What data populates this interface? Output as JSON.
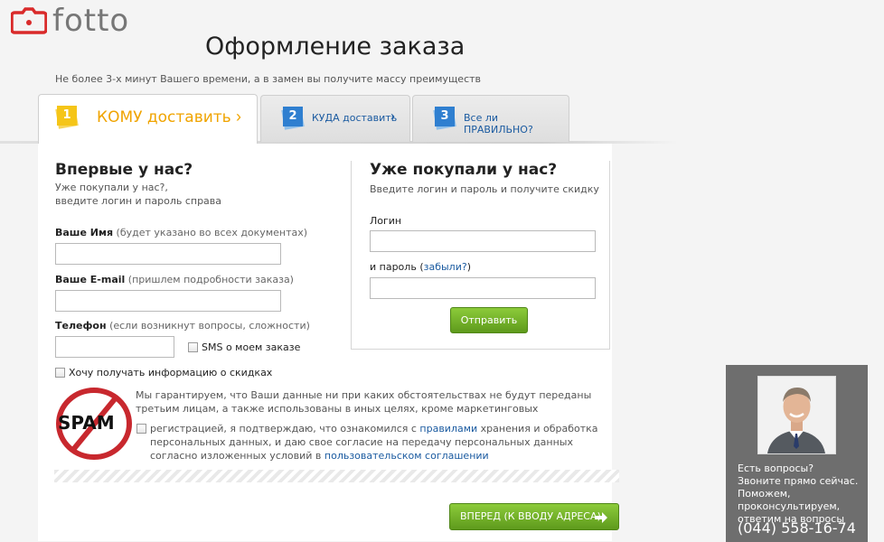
{
  "logo": {
    "text": "fotto",
    "brand_color": "#d92a2a"
  },
  "page": {
    "title": "Оформление заказа",
    "subtitle": "Не более 3-х минут Вашего времени, а в замен вы получите массу преимуществ"
  },
  "tabs": [
    {
      "number": "1",
      "label": "КОМУ доставить",
      "color": "#f5c518",
      "active": true
    },
    {
      "number": "2",
      "label": "КУДА доставить",
      "color": "#2f7fd0",
      "active": false
    },
    {
      "number": "3",
      "label": "Все ли ПРАВИЛЬНО?",
      "color": "#2f7fd0",
      "active": false
    }
  ],
  "new_customer": {
    "heading": "Впервые у нас?",
    "note_line1": "Уже покупали у нас?,",
    "note_line2": "введите логин и пароль справа",
    "name_label": "Ваше Имя",
    "name_hint": "(будет указано во всех документах)",
    "name_value": "",
    "email_label": "Ваше E-mail",
    "email_hint": "(пришлем подробности заказа)",
    "email_value": "",
    "phone_label": "Телефон",
    "phone_hint": "(если возникнут вопросы, сложности)",
    "phone_value": "",
    "sms_label": "SMS о моем заказе",
    "discount_label": "Хочу получать информацию о скидках"
  },
  "returning_customer": {
    "heading": "Уже покупали у нас?",
    "note": "Введите логин и пароль и получите скидку",
    "login_label": "Логин",
    "login_value": "",
    "password_label": "и пароль",
    "forgot_open": "(",
    "forgot_link": "забыли?",
    "forgot_close": ")",
    "password_value": "",
    "submit_label": "Отправить"
  },
  "privacy": {
    "spam_text": "SPAM",
    "guarantee": "Мы гарантируем, что Ваши данные ни при каких обстоятельствах не будут переданы третьим лицам, а также использованы в иных целях, кроме маркетинговых",
    "agree_part1": "регистрацией, я подтверждаю, что ознакомился с",
    "agree_link1": "правилами",
    "agree_part2": "хранения и обработка персональных данных, и даю свое согласие на передачу персональных данных согласно изложенных условий в",
    "agree_link2": "пользовательском соглашении"
  },
  "next_button": {
    "label": "ВПЕРЕД (К ВВОДУ АДРЕСА)",
    "icon": "arrow-right-icon"
  },
  "support": {
    "text": "Есть вопросы? Звоните прямо сейчас. Поможем, проконсультируем, ответим на вопросы",
    "phone": "(044) 558-16-74"
  }
}
